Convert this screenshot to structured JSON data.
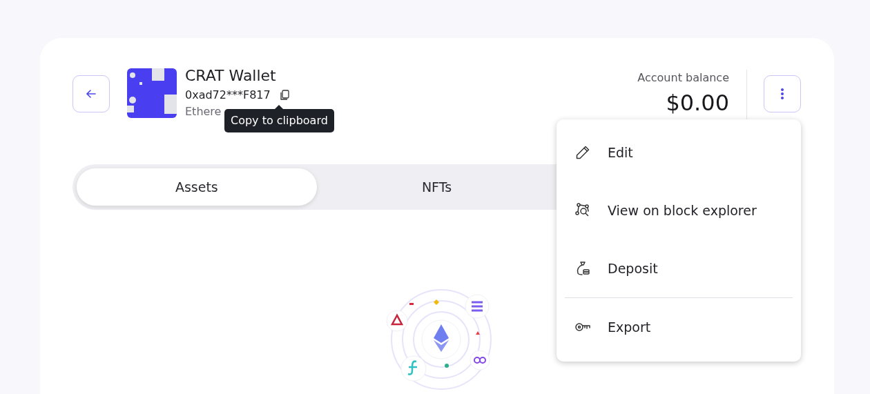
{
  "wallet": {
    "name": "CRAT Wallet",
    "address": "0xad72***F817",
    "network": "Ethere"
  },
  "tooltip": {
    "text": "Copy to clipboard"
  },
  "balance": {
    "label": "Account balance",
    "amount": "$0.00"
  },
  "tabs": [
    {
      "label": "Assets",
      "selected": true
    },
    {
      "label": "NFTs",
      "selected": false
    }
  ],
  "menu": {
    "items": [
      {
        "kind": "edit",
        "label": "Edit"
      },
      {
        "kind": "explorer",
        "label": "View on block explorer"
      },
      {
        "kind": "deposit",
        "label": "Deposit"
      },
      {
        "kind": "divider"
      },
      {
        "kind": "export",
        "label": "Export"
      }
    ]
  }
}
